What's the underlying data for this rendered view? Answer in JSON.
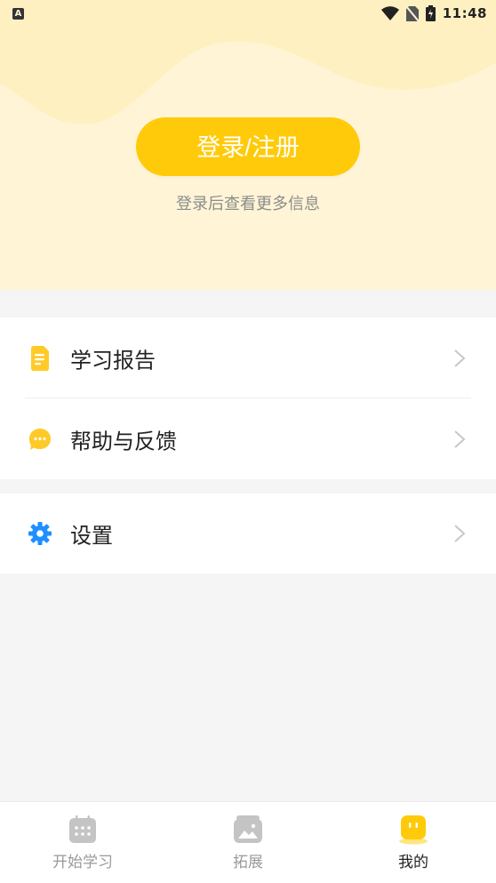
{
  "status_bar": {
    "notification_icon": "A",
    "time": "11:48",
    "icons": [
      "wifi-icon",
      "no-sim-icon",
      "battery-charging-icon"
    ]
  },
  "profile": {
    "login_button": "登录/注册",
    "login_hint": "登录后查看更多信息"
  },
  "menu": {
    "items": [
      {
        "label": "学习报告",
        "icon": "report-document-icon"
      },
      {
        "label": "帮助与反馈",
        "icon": "chat-bubble-icon"
      },
      {
        "label": "设置",
        "icon": "gear-icon"
      }
    ]
  },
  "tabbar": {
    "tabs": [
      {
        "label": "开始学习",
        "icon": "calendar-icon",
        "active": false
      },
      {
        "label": "拓展",
        "icon": "picture-icon",
        "active": false
      },
      {
        "label": "我的",
        "icon": "mascot-face-icon",
        "active": true
      }
    ]
  },
  "colors": {
    "accent": "#ffca0a",
    "header_bg": "#fff5d6",
    "header_wave": "#fff0c2",
    "settings_icon": "#1e8fff"
  }
}
